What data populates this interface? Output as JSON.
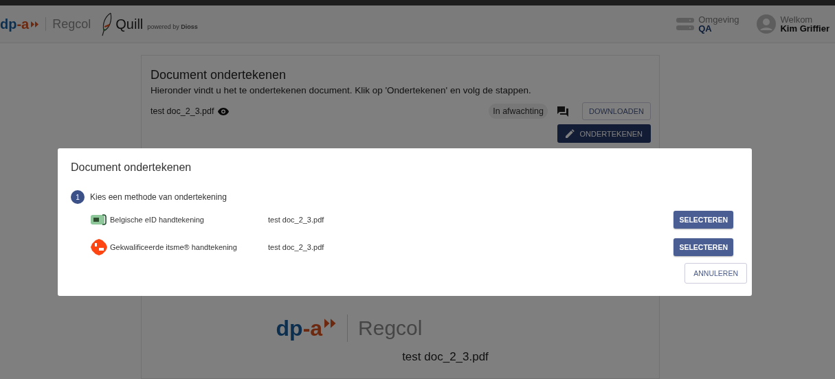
{
  "header": {
    "logo_text": "dp-a",
    "brand": "Regcol",
    "app_name": "Quill",
    "tagline": "powered by **Dioss**",
    "environment": {
      "label": "Omgeving",
      "value": "QA"
    },
    "user": {
      "greeting": "Welkom",
      "name": "Kim Griffier"
    }
  },
  "card": {
    "title": "Document ondertekenen",
    "description": "Hieronder vindt u het te ondertekenen document. Klik op 'Ondertekenen' en volg de stappen.",
    "file_name": "test doc_2_3.pdf",
    "status": "In afwachting",
    "download_button": "DOWNLOADEN",
    "sign_button": "ONDERTEKENEN",
    "preview": {
      "logo_text": "dp-a",
      "brand": "Regcol",
      "file_name": "test doc_2_3.pdf"
    }
  },
  "modal": {
    "title": "Document ondertekenen",
    "step": {
      "number": "1",
      "label": "Kies een methode van ondertekening"
    },
    "methods": [
      {
        "kind": "eid",
        "name": "Belgische eID handtekening",
        "file_name": "test doc_2_3.pdf",
        "button": "SELECTEREN"
      },
      {
        "kind": "itsme",
        "name": "Gekwalificeerde itsme® handtekening",
        "file_name": "test doc_2_3.pdf",
        "button": "SELECTEREN"
      }
    ],
    "cancel_button": "ANNULEREN"
  }
}
